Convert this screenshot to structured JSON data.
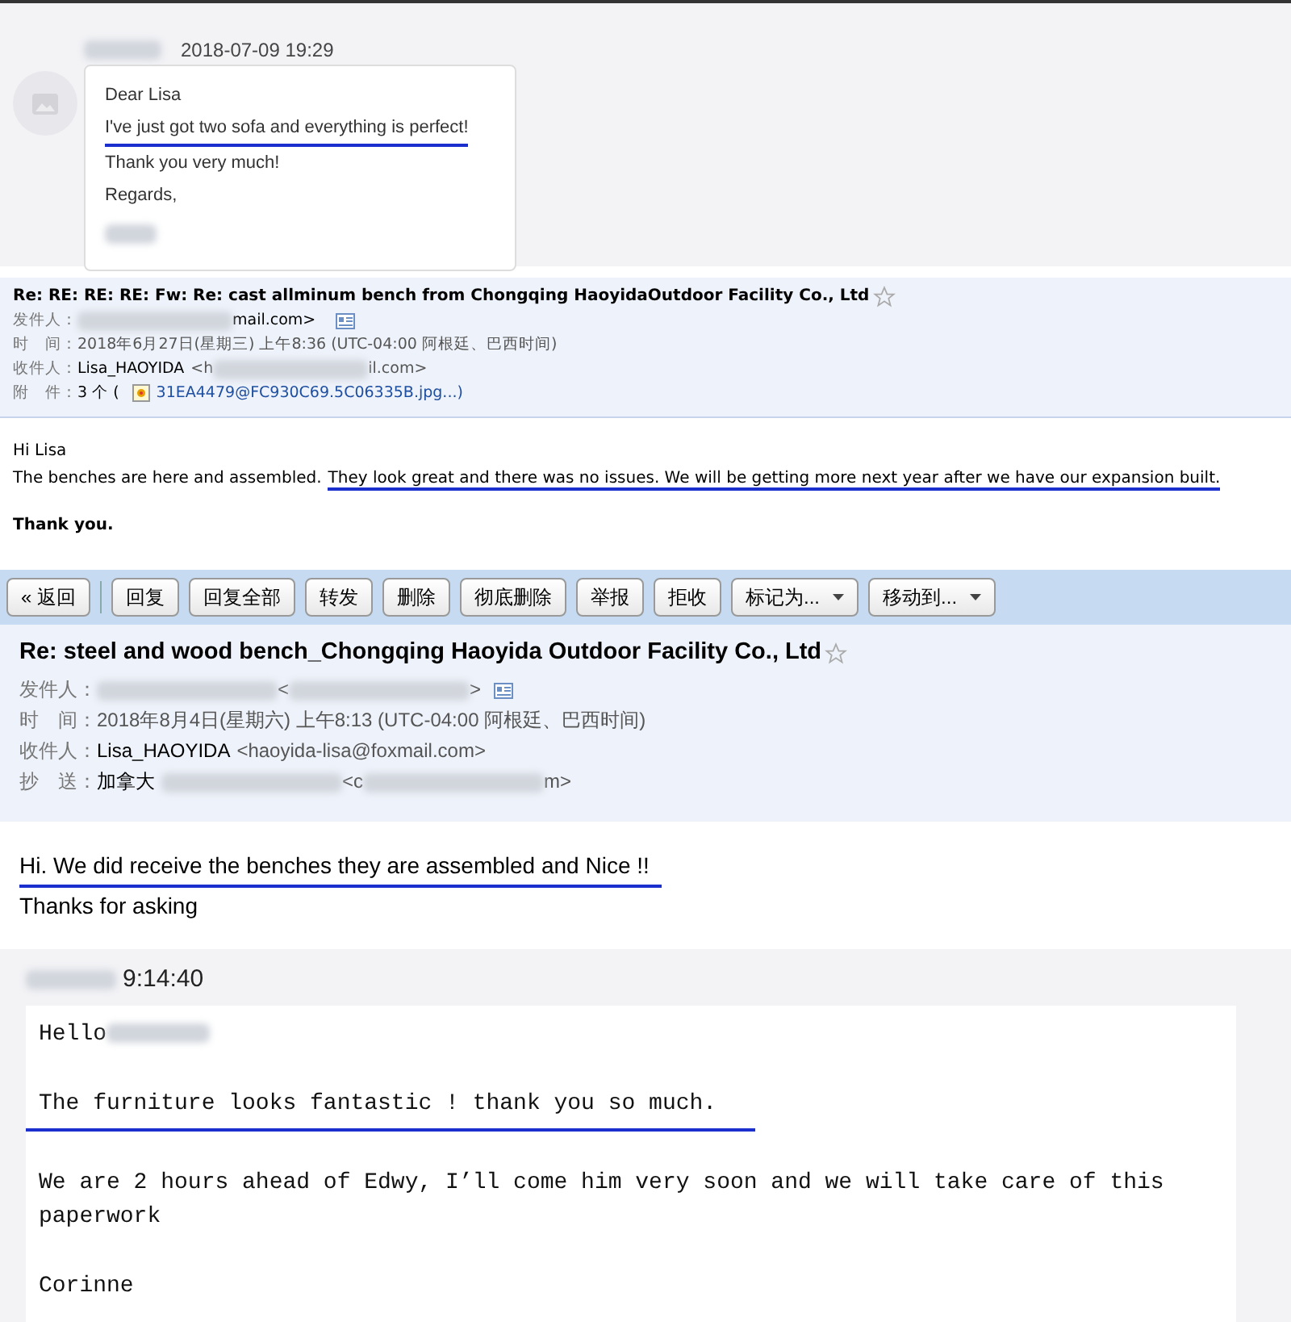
{
  "chat": {
    "timestamp": "2018-07-09 19:29",
    "sender_redacted": true,
    "lines": [
      {
        "text": "Dear Lisa",
        "underlined": false
      },
      {
        "text": "I've just got two sofa and everything is perfect!",
        "underlined": true
      },
      {
        "text": "Thank you very much!",
        "underlined": false
      },
      {
        "text": "Regards,",
        "underlined": false
      }
    ],
    "signature_redacted": true
  },
  "email_1": {
    "subject": "Re: RE: RE: RE: Fw: Re: cast allminum bench from Chongqing HaoyidaOutdoor Facility Co., Ltd",
    "fields": [
      {
        "label": "发件人：",
        "parts": [
          {
            "kind": "blur"
          },
          {
            "kind": "text",
            "text": "mail.com>"
          },
          {
            "kind": "contact_icon"
          }
        ]
      },
      {
        "label": "时　间：",
        "parts": [
          {
            "kind": "muted",
            "text": "2018年6月27日(星期三) 上午8:36 (UTC-04:00 阿根廷、巴西时间)"
          }
        ]
      },
      {
        "label": "收件人：",
        "parts": [
          {
            "kind": "text",
            "text": "Lisa_HAOYIDA"
          },
          {
            "kind": "muted",
            "text": "<h"
          },
          {
            "kind": "blur"
          },
          {
            "kind": "muted",
            "text": "il.com>"
          }
        ]
      },
      {
        "label": "附　件：",
        "parts": [
          {
            "kind": "text",
            "text": "3 个 ("
          },
          {
            "kind": "image_icon"
          },
          {
            "kind": "link",
            "text": "31EA4479@FC930C69.5C06335B.jpg...)"
          }
        ]
      }
    ],
    "body": [
      {
        "kind": "plain",
        "parts": [
          {
            "text": "Hi Lisa",
            "underlined": false
          }
        ]
      },
      {
        "kind": "plain",
        "parts": [
          {
            "text": "The benches are here and assembled.",
            "underlined": false
          },
          {
            "text": "They look great and there was no issues. We will be getting more next year after we have our expansion built.",
            "underlined": true
          }
        ]
      },
      {
        "kind": "bold",
        "parts": [
          {
            "text": "Thank you.",
            "underlined": false
          }
        ]
      }
    ]
  },
  "email_2": {
    "toolbar": [
      {
        "label": "« 返回",
        "kind": "back"
      },
      {
        "label": "回复",
        "kind": "plain"
      },
      {
        "label": "回复全部",
        "kind": "plain"
      },
      {
        "label": "转发",
        "kind": "plain"
      },
      {
        "label": "删除",
        "kind": "plain"
      },
      {
        "label": "彻底删除",
        "kind": "plain"
      },
      {
        "label": "举报",
        "kind": "plain"
      },
      {
        "label": "拒收",
        "kind": "plain"
      },
      {
        "label": "标记为...",
        "kind": "dropdown"
      },
      {
        "label": "移动到...",
        "kind": "dropdown"
      }
    ],
    "subject": "Re: steel and wood bench_Chongqing Haoyida Outdoor Facility Co., Ltd",
    "fields": [
      {
        "label": "发件人：",
        "parts": [
          {
            "kind": "blur"
          },
          {
            "kind": "muted",
            "text": "<"
          },
          {
            "kind": "blur"
          },
          {
            "kind": "muted",
            "text": ">"
          },
          {
            "kind": "contact_icon"
          }
        ]
      },
      {
        "label": "时　间：",
        "parts": [
          {
            "kind": "muted",
            "text": "2018年8月4日(星期六) 上午8:13 (UTC-04:00 阿根廷、巴西时间)"
          }
        ]
      },
      {
        "label": "收件人：",
        "parts": [
          {
            "kind": "text",
            "text": "Lisa_HAOYIDA"
          },
          {
            "kind": "muted",
            "text": "<haoyida-lisa@foxmail.com>"
          }
        ]
      },
      {
        "label": "抄　送：",
        "parts": [
          {
            "kind": "text",
            "text": "加拿大"
          },
          {
            "kind": "blur"
          },
          {
            "kind": "muted",
            "text": "<c"
          },
          {
            "kind": "blur"
          },
          {
            "kind": "muted",
            "text": "m>"
          }
        ]
      }
    ],
    "body": [
      {
        "text": "Hi. We did receive the benches they are assembled and Nice !!",
        "underlined": true
      },
      {
        "text": "Thanks for asking",
        "underlined": false
      }
    ]
  },
  "message": {
    "time": "9:14:40",
    "sender_redacted": true,
    "paragraphs": [
      {
        "kind": "greeting",
        "text": "Hello",
        "underlined": false
      },
      {
        "kind": "plain",
        "text": "The furniture looks fantastic ! thank you so much.",
        "underlined": true
      },
      {
        "kind": "plain",
        "text": "We are 2 hours ahead of Edwy, I’ll come him very soon and we will take care of this paperwork",
        "underlined": false
      },
      {
        "kind": "plain",
        "text": "Corinne",
        "underlined": false
      }
    ]
  }
}
